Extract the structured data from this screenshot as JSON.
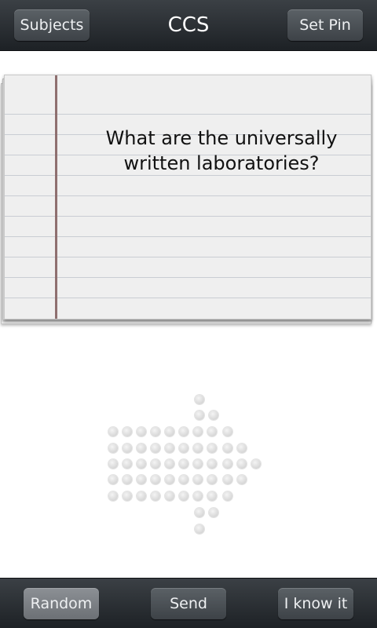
{
  "topbar": {
    "subjects_label": "Subjects",
    "title": "CCS",
    "set_pin_label": "Set Pin"
  },
  "card": {
    "question_line1": "What are the universally",
    "question_line2": "written laboratories?"
  },
  "bottombar": {
    "random_label": "Random",
    "send_label": "Send",
    "i_know_it_label": "I know it"
  },
  "arrow": {
    "icon": "next-arrow-icon",
    "direction": "right"
  }
}
